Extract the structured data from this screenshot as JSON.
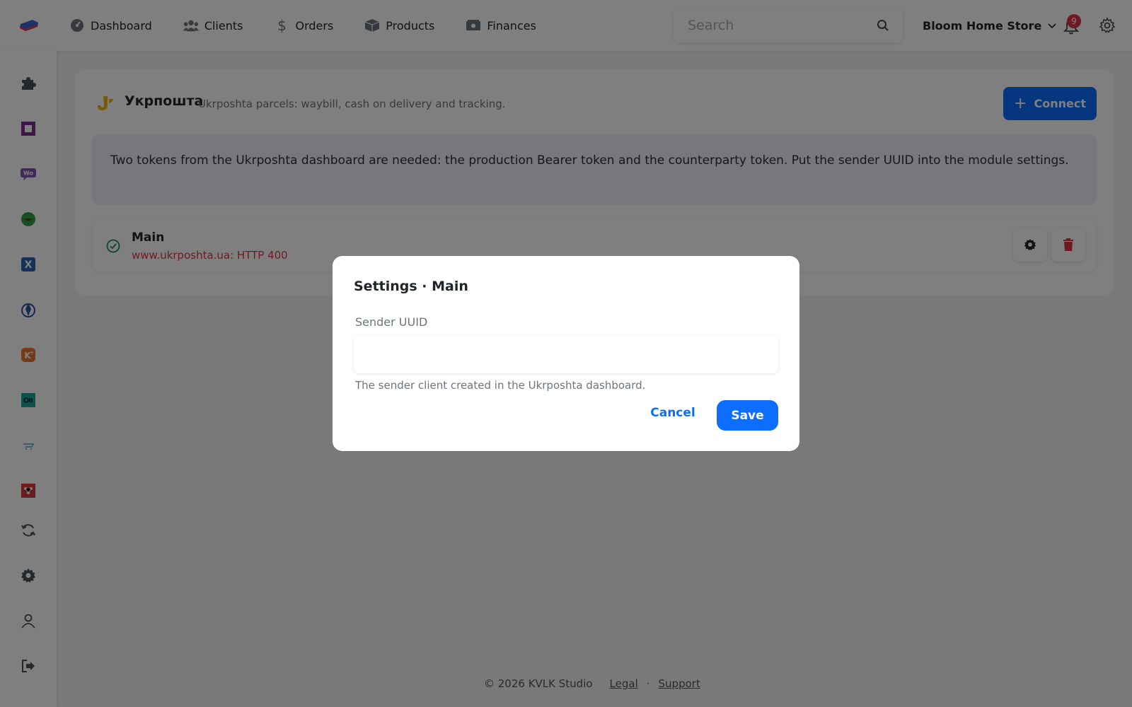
{
  "nav": {
    "items": [
      {
        "label": "Dashboard",
        "icon": "dashboard-gauge-icon"
      },
      {
        "label": "Clients",
        "icon": "users-icon"
      },
      {
        "label": "Orders",
        "icon": "dollar-icon"
      },
      {
        "label": "Products",
        "icon": "box-icon"
      },
      {
        "label": "Finances",
        "icon": "cash-icon"
      }
    ],
    "search_placeholder": "Search",
    "store_name": "Bloom Home Store",
    "notification_count": "9"
  },
  "sidebar": {
    "icons": [
      "puzzle-icon",
      "square-icon",
      "woo-icon",
      "green-app-icon",
      "x-app-icon",
      "shield-app-icon",
      "k-app-icon",
      "teal-app-icon",
      "cart-icon",
      "red-app-icon",
      "sync-icon",
      "gear-icon",
      "user-icon",
      "logout-icon"
    ]
  },
  "card": {
    "title": "Укрпошта",
    "subtitle": "Ukrposhta parcels: waybill, cash on delivery and tracking.",
    "connect_label": "Connect",
    "info_text": "Two tokens from the Ukrposhta dashboard are needed: the production Bearer token and the counterparty token. Put the sender UUID into the module settings.",
    "connection": {
      "name": "Main",
      "status_text": "www.ukrposhta.ua: HTTP 400"
    }
  },
  "footer": {
    "copyright": "© 2026 KVLK Studio",
    "legal": "Legal",
    "separator": "·",
    "support": "Support"
  },
  "modal": {
    "title": "Settings · Main",
    "field_label": "Sender UUID",
    "field_value": "",
    "field_hint": "The sender client created in the Ukrposhta dashboard.",
    "cancel_label": "Cancel",
    "save_label": "Save"
  },
  "colors": {
    "primary": "#0d6efd",
    "danger": "#dc3545",
    "success": "#198754",
    "overlay": "rgba(0,0,0,0.5)"
  }
}
